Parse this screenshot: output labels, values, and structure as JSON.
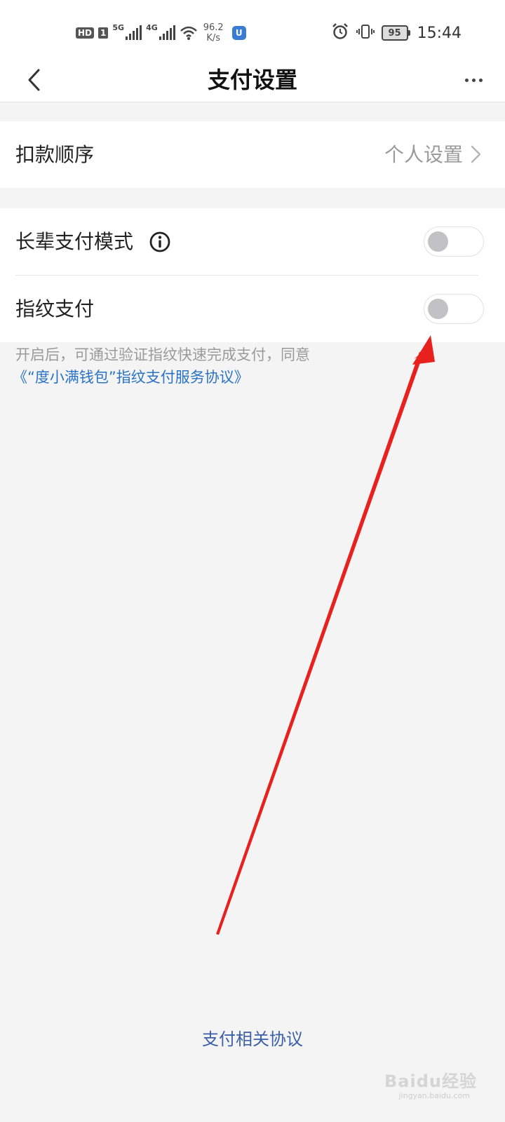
{
  "status_bar": {
    "hd": "HD",
    "sim": "1",
    "net1": "5G",
    "net2": "4G",
    "speed_value": "96.2",
    "speed_unit": "K/s",
    "app_badge": "U",
    "battery": "95",
    "time": "15:44"
  },
  "nav": {
    "title": "支付设置"
  },
  "deduction": {
    "label": "扣款顺序",
    "value": "个人设置"
  },
  "elder_mode": {
    "label": "长辈支付模式",
    "enabled": false
  },
  "fingerprint": {
    "label": "指纹支付",
    "enabled": false
  },
  "description": {
    "text": "开启后，可通过验证指纹快速完成支付，同意",
    "link": "《“度小满钱包”指纹支付服务协议》"
  },
  "footer": {
    "link": "支付相关协议"
  },
  "watermark": {
    "brand": "Baidu经验",
    "url": "jingyan.baidu.com"
  },
  "colors": {
    "accent_link": "#2a73c4",
    "annotation_arrow": "#e8211f"
  }
}
